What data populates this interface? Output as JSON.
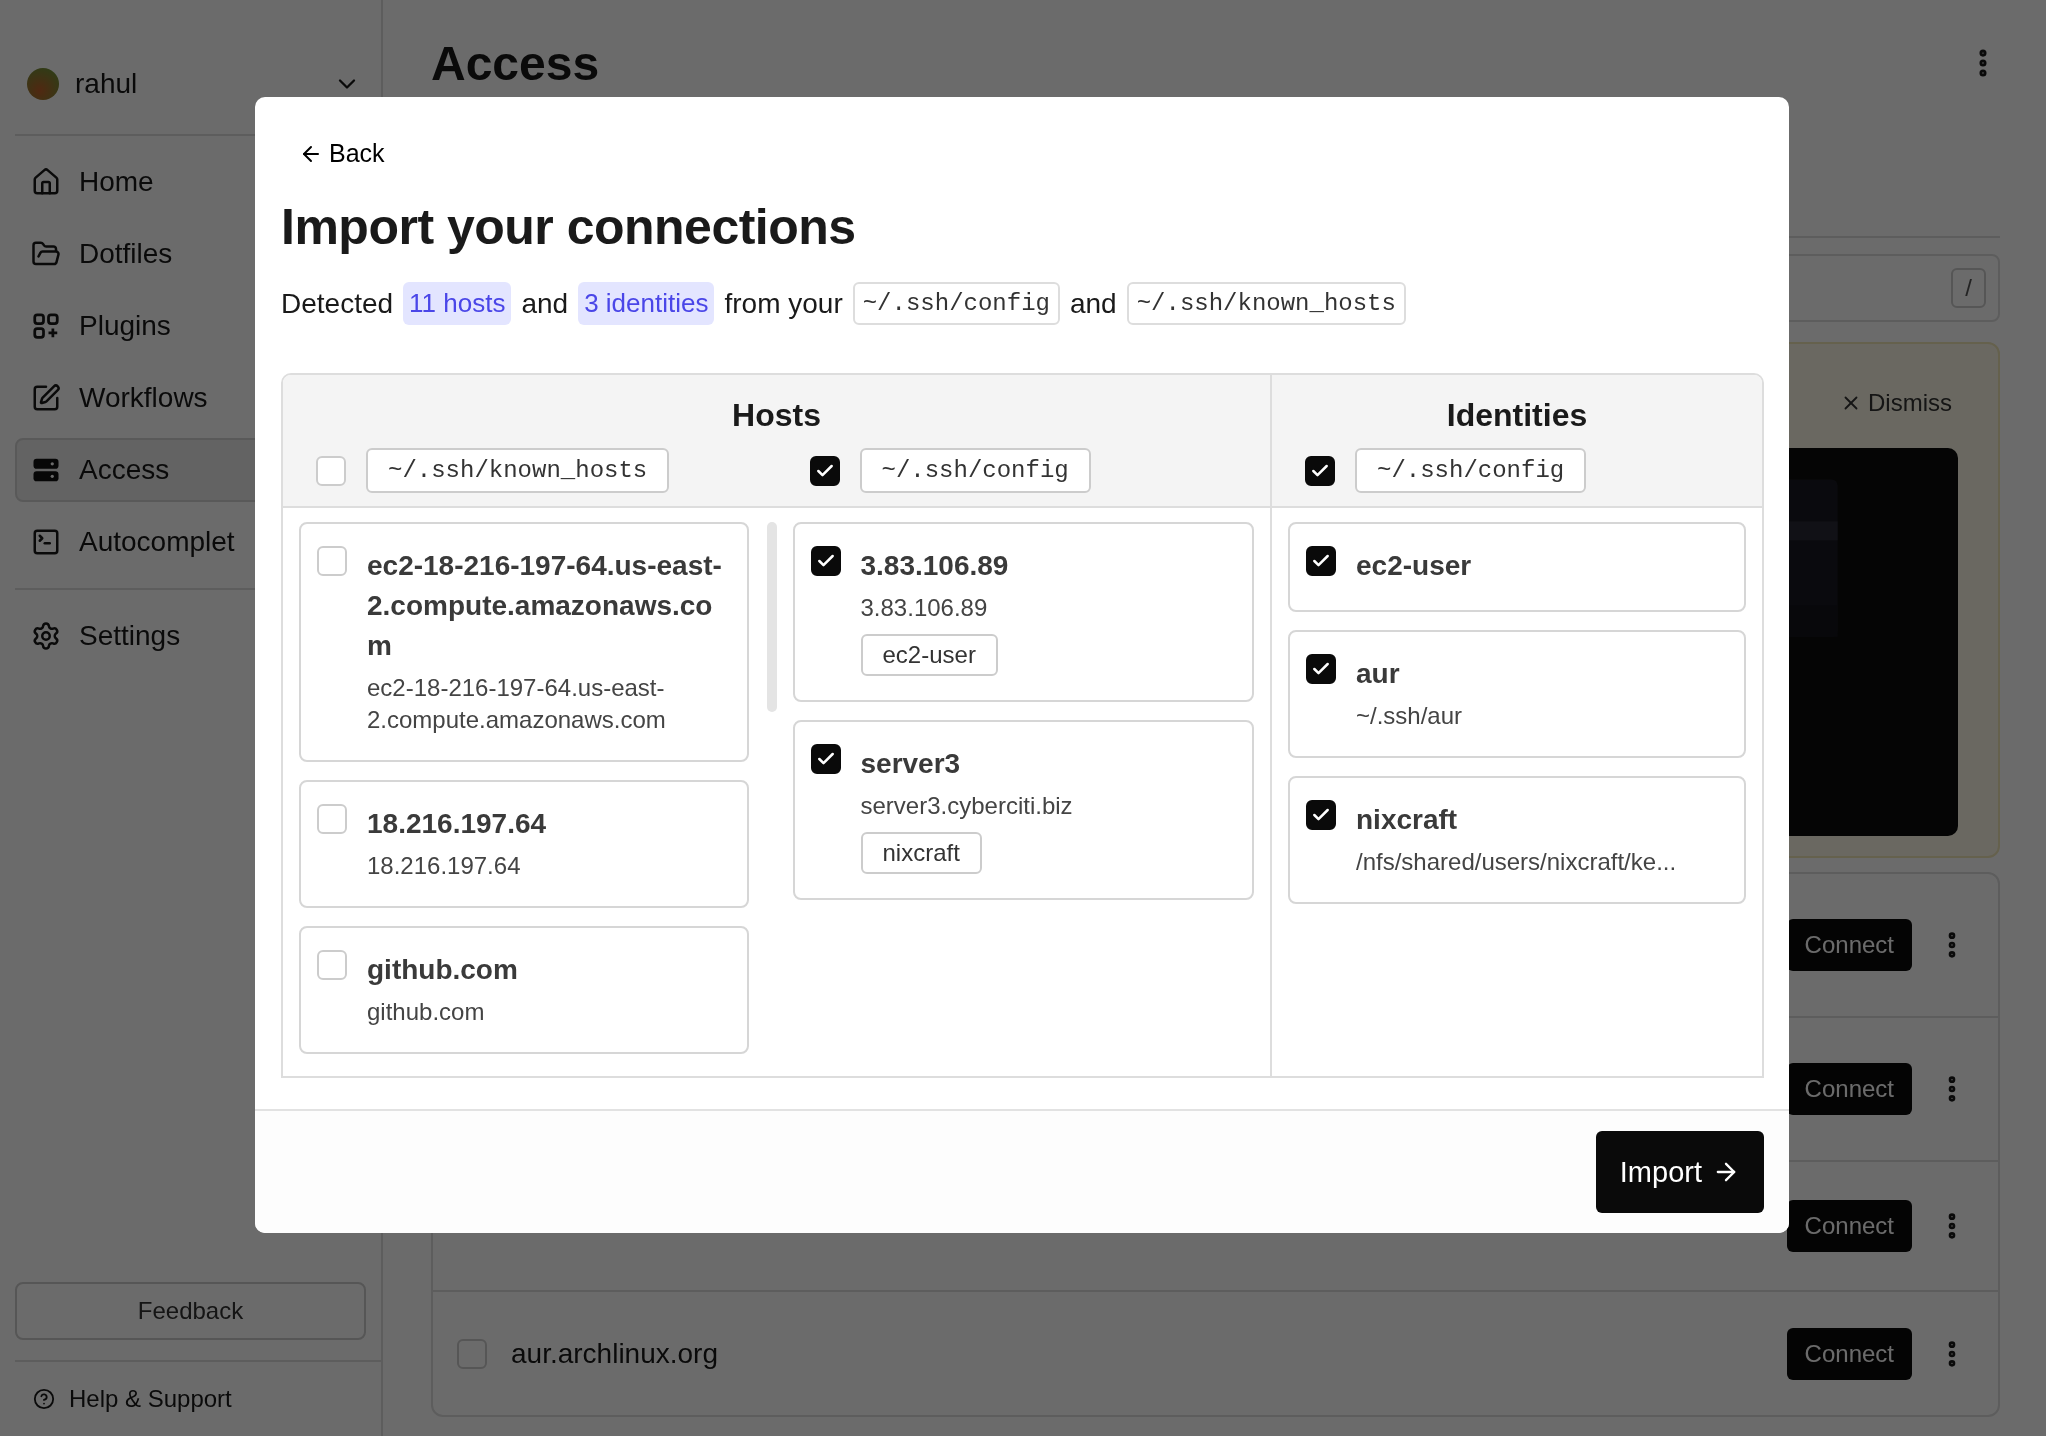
{
  "sidebar": {
    "user": {
      "name": "rahul"
    },
    "items": [
      {
        "label": "Home",
        "selected": false
      },
      {
        "label": "Dotfiles",
        "selected": false
      },
      {
        "label": "Plugins",
        "selected": false
      },
      {
        "label": "Workflows",
        "selected": false
      },
      {
        "label": "Access",
        "selected": true
      },
      {
        "label": "Autocomplet",
        "selected": false
      }
    ],
    "settings": {
      "label": "Settings",
      "selected": false
    },
    "feedback": "Feedback",
    "help": "Help & Support"
  },
  "page": {
    "title": "Access",
    "search_key": "/",
    "banner": {
      "dismiss": "Dismiss"
    },
    "rows": [
      {
        "connect": "Connect"
      },
      {
        "connect": "Connect"
      },
      {
        "connect": "Connect"
      },
      {
        "name": "aur.archlinux.org",
        "checked": false,
        "connect": "Connect"
      }
    ]
  },
  "dialog": {
    "back": "Back",
    "title": "Import your connections",
    "summary": [
      {
        "kind": "text",
        "text": "Detected"
      },
      {
        "kind": "count",
        "text": "11 hosts"
      },
      {
        "kind": "text",
        "text": "and"
      },
      {
        "kind": "count",
        "text": "3 identities"
      },
      {
        "kind": "text",
        "text": "from your"
      },
      {
        "kind": "path",
        "text": "~/.ssh/config"
      },
      {
        "kind": "text",
        "text": "and"
      },
      {
        "kind": "path",
        "text": "~/.ssh/known_hosts"
      }
    ],
    "hosts": {
      "title": "Hosts",
      "sources": [
        {
          "label": "~/.ssh/known_hosts",
          "checked": false,
          "items": [
            {
              "name": "ec2-18-216-197-64.us-east-2.compute.amazonaws.com",
              "detail": "ec2-18-216-197-64.us-east-2.compute.amazonaws.com",
              "checked": false
            },
            {
              "name": "18.216.197.64",
              "detail": "18.216.197.64",
              "checked": false
            },
            {
              "name": "github.com",
              "detail": "github.com",
              "checked": false
            }
          ]
        },
        {
          "label": "~/.ssh/config",
          "checked": true,
          "items": [
            {
              "name": "3.83.106.89",
              "detail": "3.83.106.89",
              "tag": "ec2-user",
              "checked": true
            },
            {
              "name": "server3",
              "detail": "server3.cyberciti.biz",
              "tag": "nixcraft",
              "checked": true
            }
          ]
        }
      ]
    },
    "identities": {
      "title": "Identities",
      "sources": [
        {
          "label": "~/.ssh/config",
          "checked": true,
          "items": [
            {
              "name": "ec2-user",
              "checked": true
            },
            {
              "name": "aur",
              "detail": "~/.ssh/aur",
              "checked": true
            },
            {
              "name": "nixcraft",
              "detail": "/nfs/shared/users/nixcraft/ke...",
              "checked": true
            }
          ]
        }
      ]
    },
    "import": "Import"
  }
}
